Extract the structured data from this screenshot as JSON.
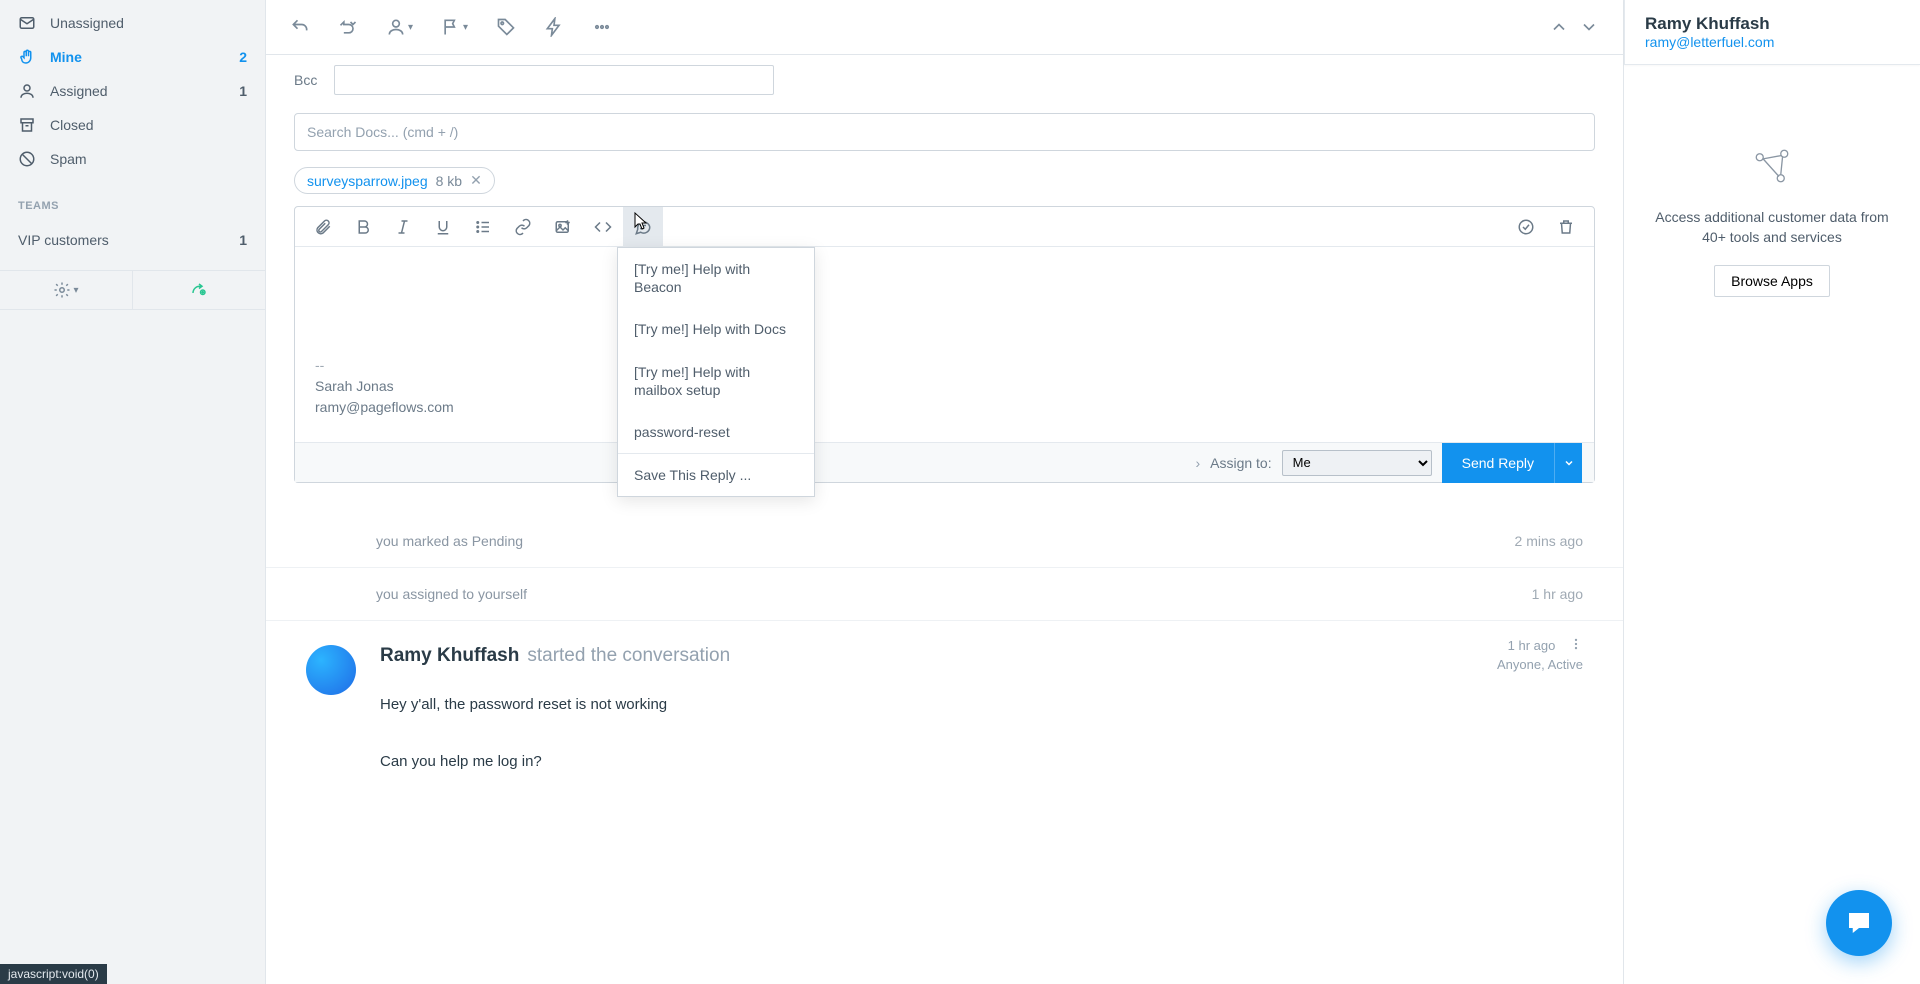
{
  "sidebar": {
    "items": [
      {
        "label": "Unassigned",
        "count": ""
      },
      {
        "label": "Mine",
        "count": "2"
      },
      {
        "label": "Assigned",
        "count": "1"
      },
      {
        "label": "Closed",
        "count": ""
      },
      {
        "label": "Spam",
        "count": ""
      }
    ],
    "teams_header": "TEAMS",
    "team_items": [
      {
        "label": "VIP customers",
        "count": "1"
      }
    ]
  },
  "compose": {
    "bcc_label": "Bcc",
    "search_placeholder": "Search Docs... (cmd + /)",
    "attachment": {
      "name": "surveysparrow.jpeg",
      "size": "8 kb"
    },
    "body_sep": "--",
    "sig_name": "Sarah Jonas",
    "sig_email": "ramy@pageflows.com",
    "assign_label": "Assign to:",
    "assign_value": "Me",
    "send_label": "Send Reply"
  },
  "saved_replies": {
    "items": [
      "[Try me!] Help with Beacon",
      "[Try me!] Help with Docs",
      "[Try me!] Help with mailbox setup",
      "password-reset"
    ],
    "footer": "Save This Reply ..."
  },
  "activity": [
    {
      "text": "you marked as Pending",
      "ts": "2 mins ago"
    },
    {
      "text": "you assigned to yourself",
      "ts": "1 hr ago"
    }
  ],
  "conversation": {
    "name": "Ramy Khuffash",
    "verb": "started the conversation",
    "ts": "1 hr ago",
    "status": "Anyone, Active",
    "msg_line1": "Hey y'all, the password reset is not working",
    "msg_line2": "Can you help me log in?"
  },
  "contact": {
    "name": "Ramy Khuffash",
    "email": "ramy@letterfuel.com"
  },
  "rpanel": {
    "text": "Access additional customer data from 40+ tools and services",
    "browse": "Browse Apps"
  },
  "status_bar": "javascript:void(0)"
}
